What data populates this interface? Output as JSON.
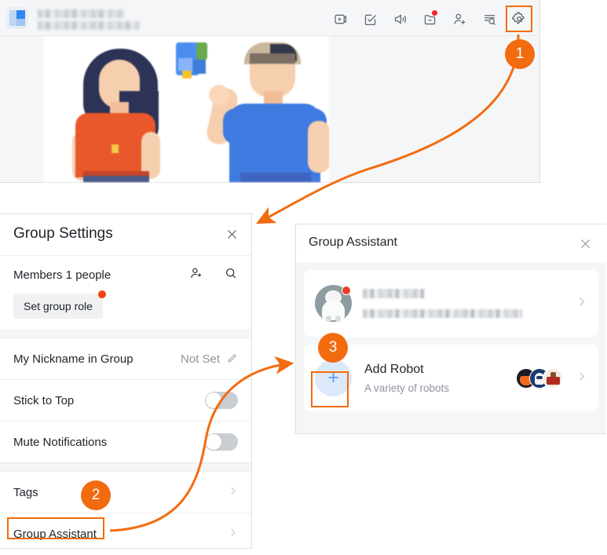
{
  "accent_color": "#f36b0f",
  "chat_window": {
    "avatar_icon": "group-avatar-icon",
    "title_masked": "",
    "subtitle_masked": "",
    "toolbar": [
      {
        "name": "video-play-icon",
        "label": "Video"
      },
      {
        "name": "task-checklist-icon",
        "label": "Tasks"
      },
      {
        "name": "announcement-speaker-icon",
        "label": "Announcement"
      },
      {
        "name": "folder-minus-icon",
        "label": "Files",
        "has_red_dot": true
      },
      {
        "name": "add-member-icon",
        "label": "Add Member"
      },
      {
        "name": "search-history-icon",
        "label": "Search History"
      },
      {
        "name": "gear-icon",
        "label": "Group Settings",
        "highlighted": true
      }
    ],
    "illustration_alt": "two-people-illustration"
  },
  "group_settings": {
    "title": "Group Settings",
    "close_icon": "close-icon",
    "members": {
      "label": "Members 1 people",
      "add_member_icon": "add-member-icon",
      "search_icon": "search-icon"
    },
    "set_group_role": {
      "label": "Set group role",
      "has_red_dot": true
    },
    "rows": [
      {
        "label": "My Nickname in Group",
        "value": "Not Set",
        "trailing": "pencil-icon"
      },
      {
        "label": "Stick to Top",
        "trailing": "toggle",
        "toggle_on": false
      },
      {
        "label": "Mute Notifications",
        "trailing": "toggle",
        "toggle_on": false
      },
      {
        "label": "Tags",
        "trailing": "chevron-right-icon"
      },
      {
        "label": "Group Assistant",
        "trailing": "chevron-right-icon",
        "highlighted": true
      }
    ]
  },
  "group_assistant": {
    "title": "Group Assistant",
    "close_icon": "close-icon",
    "bot_entry": {
      "avatar_icon": "robot-avatar-icon",
      "name_masked": "",
      "desc_masked": "",
      "chevron": "chevron-right-icon"
    },
    "add_robot": {
      "title": "Add Robot",
      "subtitle": "A variety of robots",
      "plus_icon": "plus-icon",
      "plus_symbol": "+",
      "chevron": "chevron-right-icon",
      "robot_avatars": [
        "fox-robot-avatar",
        "blue-robot-avatar",
        "shrine-robot-avatar"
      ]
    }
  },
  "steps": [
    {
      "number": "1",
      "target": "gear-icon"
    },
    {
      "number": "2",
      "target": "group-assistant-row"
    },
    {
      "number": "3",
      "target": "add-robot-row"
    }
  ]
}
